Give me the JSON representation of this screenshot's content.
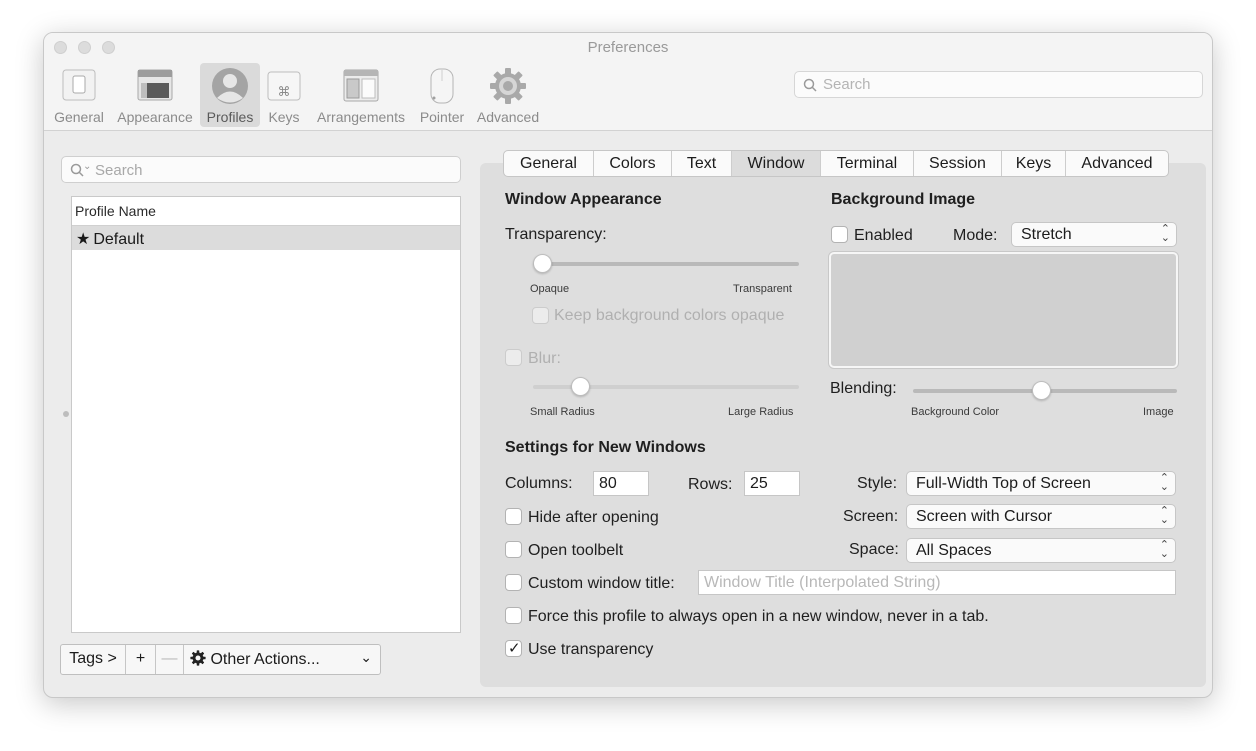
{
  "window": {
    "title": "Preferences"
  },
  "toolbar": {
    "items": [
      {
        "label": "General",
        "icon": "general-switch-icon"
      },
      {
        "label": "Appearance",
        "icon": "appearance-window-icon"
      },
      {
        "label": "Profiles",
        "icon": "profile-avatar-icon"
      },
      {
        "label": "Keys",
        "icon": "command-key-icon"
      },
      {
        "label": "Arrangements",
        "icon": "arrangements-icon"
      },
      {
        "label": "Pointer",
        "icon": "mouse-icon"
      },
      {
        "label": "Advanced",
        "icon": "gear-icon"
      }
    ],
    "selected": "Profiles",
    "search_placeholder": "Search"
  },
  "left": {
    "search_placeholder": "Search",
    "column_header": "Profile Name",
    "profiles": [
      {
        "name": "Default",
        "is_default": true
      }
    ],
    "bottom": {
      "tags": "Tags >",
      "add": "+",
      "remove": "—",
      "other_actions": "Other Actions..."
    }
  },
  "tabs": [
    {
      "label": "General"
    },
    {
      "label": "Colors"
    },
    {
      "label": "Text"
    },
    {
      "label": "Window"
    },
    {
      "label": "Terminal"
    },
    {
      "label": "Session"
    },
    {
      "label": "Keys"
    },
    {
      "label": "Advanced"
    }
  ],
  "selected_tab": "Window",
  "appearance": {
    "heading": "Window Appearance",
    "transparency_label": "Transparency:",
    "transparency_min": "Opaque",
    "transparency_max": "Transparent",
    "transparency_value": 0.0,
    "keep_bg_opaque": "Keep background colors opaque",
    "keep_bg_opaque_checked": false,
    "blur_label": "Blur:",
    "blur_checked": false,
    "blur_min": "Small Radius",
    "blur_max": "Large Radius",
    "blur_value": 0.15
  },
  "background": {
    "heading": "Background Image",
    "enabled_label": "Enabled",
    "enabled_checked": false,
    "mode_label": "Mode:",
    "mode_value": "Stretch",
    "blending_label": "Blending:",
    "blending_min": "Background Color",
    "blending_max": "Image",
    "blending_value": 0.48
  },
  "new_windows": {
    "heading": "Settings for New Windows",
    "columns_label": "Columns:",
    "columns_value": "80",
    "rows_label": "Rows:",
    "rows_value": "25",
    "style_label": "Style:",
    "style_value": "Full-Width Top of Screen",
    "screen_label": "Screen:",
    "screen_value": "Screen with Cursor",
    "space_label": "Space:",
    "space_value": "All Spaces",
    "hide_after_opening": "Hide after opening",
    "hide_after_opening_checked": false,
    "open_toolbelt": "Open toolbelt",
    "open_toolbelt_checked": false,
    "custom_title": "Custom window title:",
    "custom_title_checked": false,
    "custom_title_placeholder": "Window Title (Interpolated String)",
    "force_new_window": "Force this profile to always open in a new window, never in a tab.",
    "force_new_window_checked": false,
    "use_transparency": "Use transparency",
    "use_transparency_checked": true,
    "check_glyph": "✓"
  }
}
